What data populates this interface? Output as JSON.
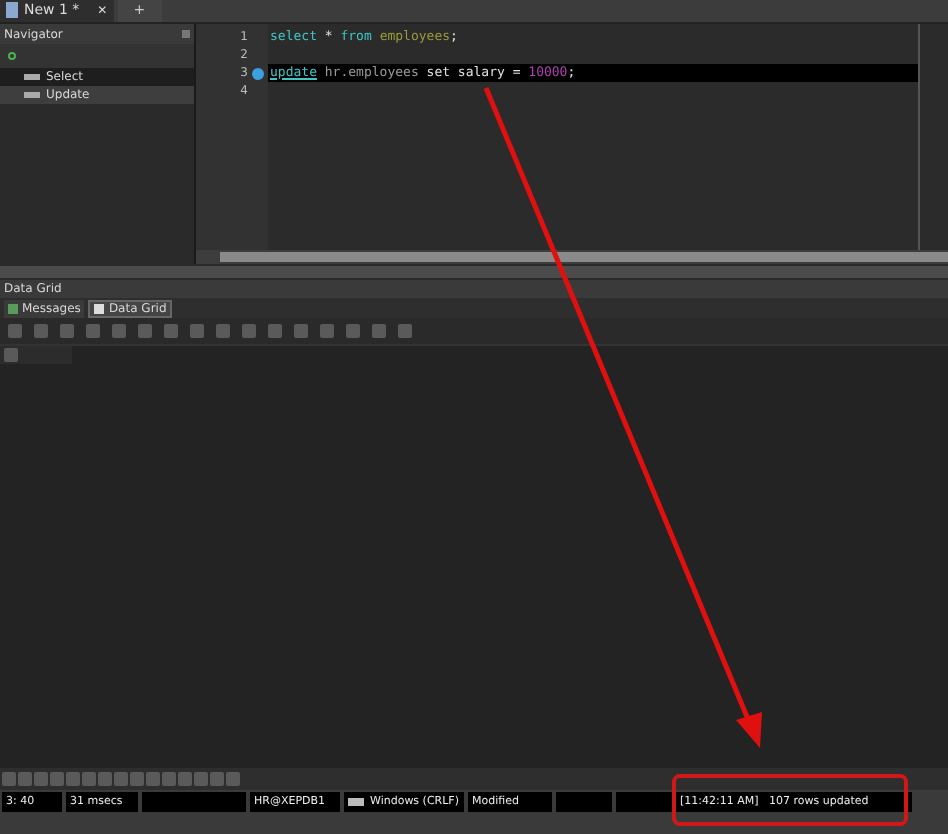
{
  "tabs": [
    {
      "label": "New 1 *",
      "close": "✕",
      "selected": true
    },
    {
      "label": "+",
      "selected": false
    }
  ],
  "navigator": {
    "title": "Navigator",
    "items": [
      {
        "label": "Select",
        "selected": false
      },
      {
        "label": "Update",
        "selected": true
      }
    ]
  },
  "editor": {
    "lines": [
      {
        "number": "1",
        "current": false,
        "tokens": [
          {
            "kind": "keyword",
            "text": "select"
          },
          {
            "kind": "plain",
            "text": " * "
          },
          {
            "kind": "keyword",
            "text": "from "
          },
          {
            "kind": "table",
            "text": "employees"
          },
          {
            "kind": "plain",
            "text": ";"
          }
        ]
      },
      {
        "number": "2",
        "current": false
      },
      {
        "number": "3",
        "current": true,
        "tokens": [
          {
            "kind": "keyword",
            "text": "update"
          },
          {
            "kind": "ident",
            "text": " hr.employees "
          },
          {
            "kind": "plain",
            "text": "set salary = "
          },
          {
            "kind": "number",
            "text": "10000"
          },
          {
            "kind": "plain",
            "text": ";"
          }
        ]
      },
      {
        "number": "4",
        "current": false
      }
    ]
  },
  "data_grid": {
    "title": "Data Grid",
    "tabs": [
      {
        "label": "Messages",
        "selected": false
      },
      {
        "label": "Data Grid",
        "selected": true
      }
    ]
  },
  "status_bar": [
    {
      "kind": "text",
      "text": "3: 40"
    },
    {
      "kind": "text",
      "text": "31 msecs"
    },
    {
      "kind": "blank"
    },
    {
      "kind": "text",
      "text": "HR@XEPDB1"
    },
    {
      "kind": "line_ending",
      "text": "Windows (CRLF)"
    },
    {
      "kind": "text",
      "text": "Modified"
    },
    {
      "kind": "blank"
    },
    {
      "kind": "blank"
    },
    {
      "kind": "text",
      "text": "[11:42:11 AM]   107 rows updated"
    }
  ]
}
